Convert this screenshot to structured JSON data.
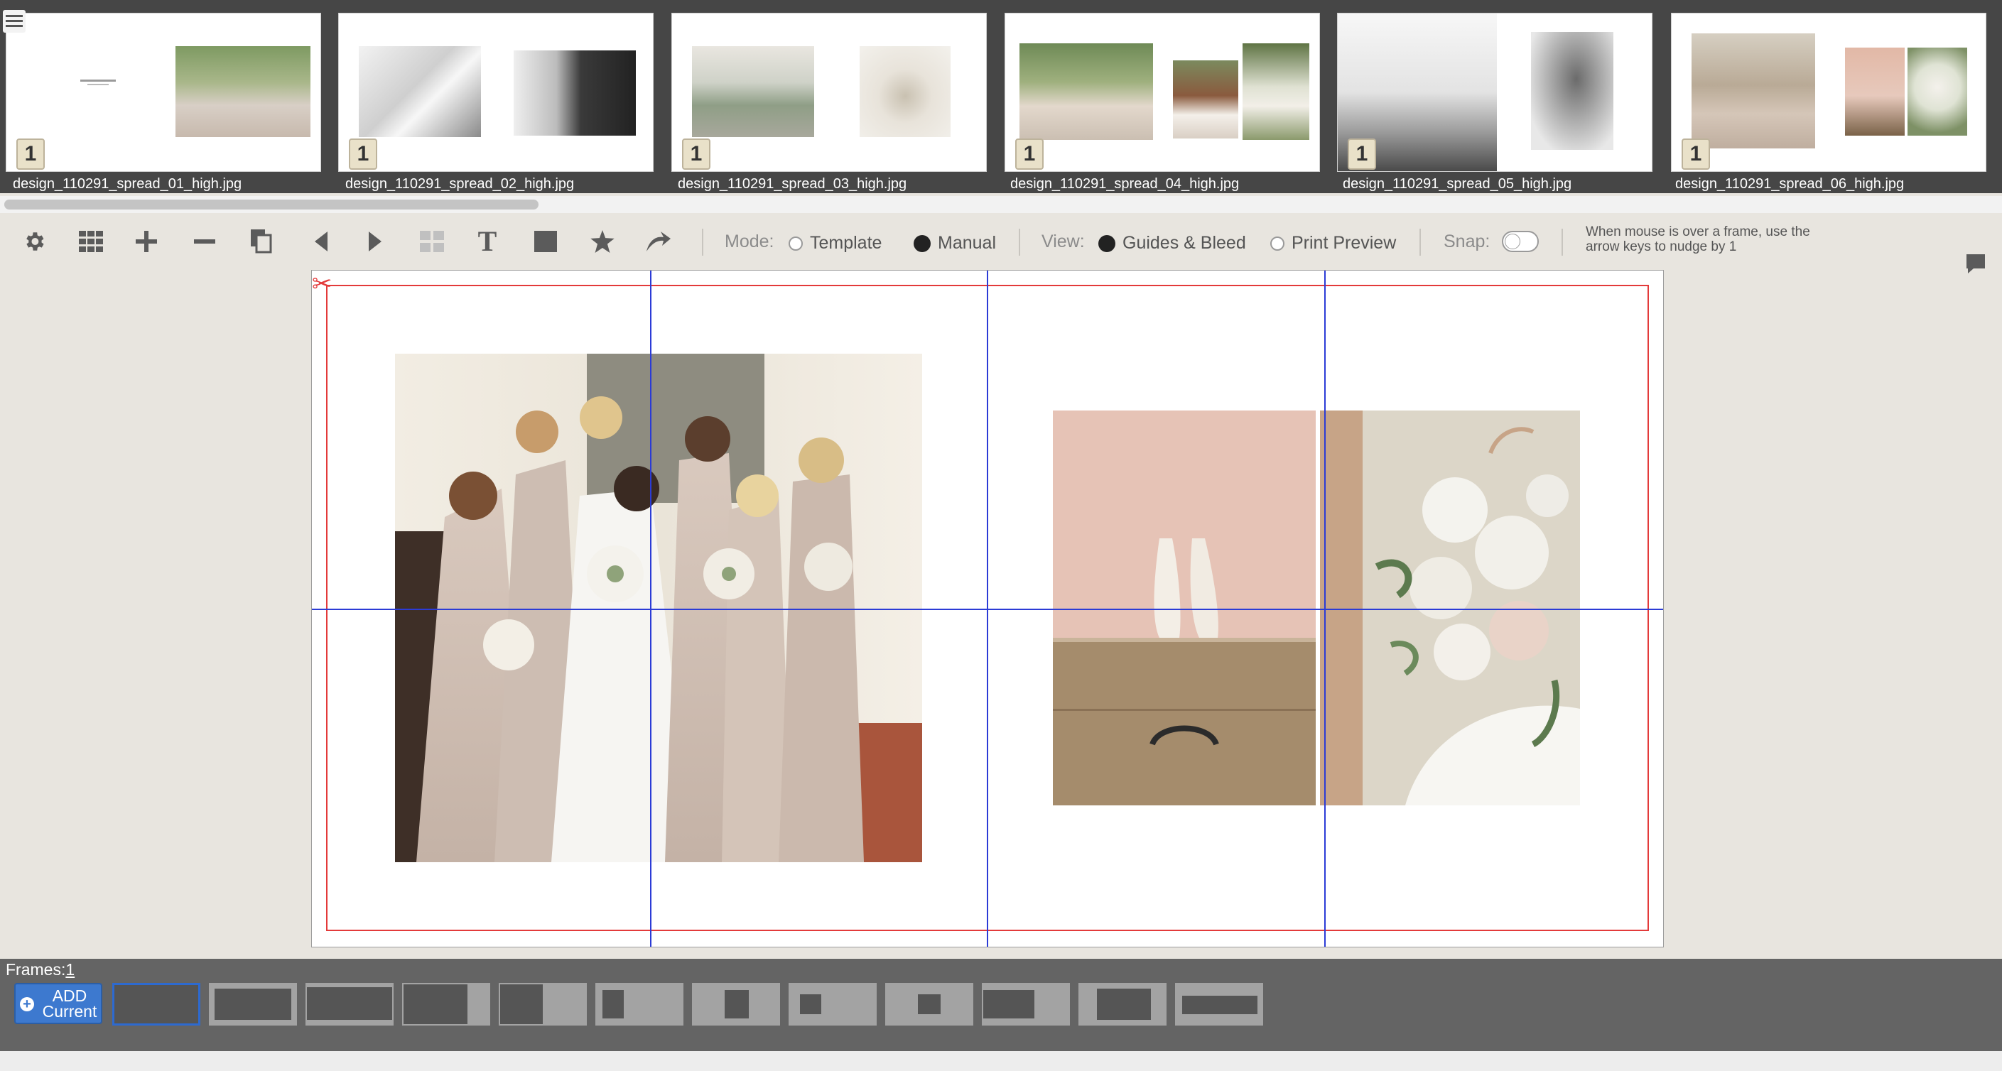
{
  "filmstrip": {
    "thumbs": [
      {
        "label": "design_110291_spread_01_high.jpg",
        "frame_count": "1"
      },
      {
        "label": "design_110291_spread_02_high.jpg",
        "frame_count": "1"
      },
      {
        "label": "design_110291_spread_03_high.jpg",
        "frame_count": "1"
      },
      {
        "label": "design_110291_spread_04_high.jpg",
        "frame_count": "1"
      },
      {
        "label": "design_110291_spread_05_high.jpg",
        "frame_count": "1"
      },
      {
        "label": "design_110291_spread_06_high.jpg",
        "frame_count": "1"
      }
    ]
  },
  "toolbar": {
    "icons": [
      "gear-icon",
      "grid-icon",
      "plus-icon",
      "minus-icon",
      "copy-icon",
      "prev-arrow-icon",
      "next-arrow-icon",
      "layout-icon",
      "text-icon",
      "box-icon",
      "star-icon",
      "undo-icon"
    ],
    "mode_label": "Mode:",
    "mode_options": [
      {
        "label": "Template",
        "selected": false
      },
      {
        "label": "Manual",
        "selected": true
      }
    ],
    "view_label": "View:",
    "view_options": [
      {
        "label": "Guides & Bleed",
        "selected": true
      },
      {
        "label": "Print Preview",
        "selected": false
      }
    ],
    "snap_label": "Snap:",
    "snap_on": false,
    "hint": "When mouse is over a frame, use the arrow keys to nudge by 1"
  },
  "frames": {
    "label": "Frames:",
    "count": "1",
    "add_button": "ADD Current"
  },
  "colors": {
    "bleed_line": "#e33a3a",
    "guide_line": "#2b3bd6",
    "filmstrip_bg": "#464646",
    "toolbar_bg": "#e8e5df",
    "frames_bar_bg": "#646464",
    "add_button_bg": "#3d79cf",
    "selected_layout_border": "#2d6ad0"
  }
}
